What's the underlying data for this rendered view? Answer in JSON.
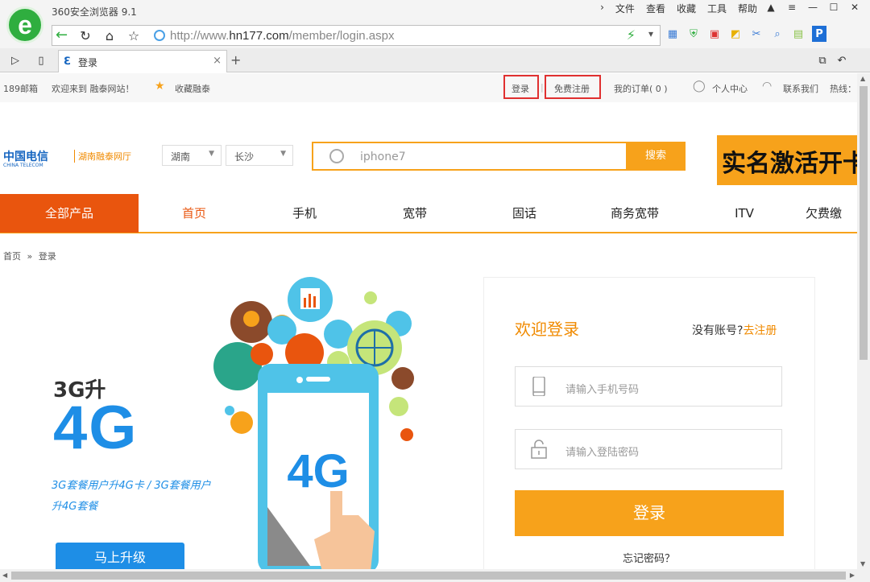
{
  "browser": {
    "app_title": "360安全浏览器 9.1",
    "menu": [
      "文件",
      "查看",
      "收藏",
      "工具",
      "帮助"
    ],
    "url_prefix": "http://www.",
    "url_domain": "hn177.com",
    "url_path": "/member/login.aspx",
    "tab_label": "登录",
    "tab_close": "×",
    "new_tab": "+"
  },
  "topbar": {
    "mail": "189邮箱",
    "welcome": "欢迎来到 融泰网站！",
    "favorite": "收藏融泰",
    "login": "登录",
    "separator": "|",
    "register": "免费注册",
    "orders": "我的订单( 0 )",
    "personal": "个人中心",
    "contact": "联系我们",
    "hotline": "热线："
  },
  "header": {
    "logo": "中国电信",
    "logo_sub": "CHINA TELECOM",
    "hall": "湖南融泰网厅",
    "province": "湖南",
    "city": "长沙",
    "search_placeholder": "iphone7",
    "search_button": "搜索",
    "banner": "实名激活开卡"
  },
  "nav": {
    "all": "全部产品",
    "items": [
      "首页",
      "手机",
      "宽带",
      "固话",
      "商务宽带",
      "ITV",
      "欠费缴"
    ]
  },
  "breadcrumb": {
    "home": "首页",
    "sep": "»",
    "current": "登录"
  },
  "promo": {
    "upgrade": "3G升",
    "big": "4G",
    "desc1": "3G套餐用户升4G卡 / 3G套餐用户",
    "desc2": "升4G套餐",
    "button": "马上升级",
    "phone_text": "4G"
  },
  "login": {
    "welcome": "欢迎登录",
    "no_account": "没有账号?",
    "register_link": "去注册",
    "phone_placeholder": "请输入手机号码",
    "password_placeholder": "请输入登陆密码",
    "button": "登录",
    "forgot": "忘记密码？"
  },
  "colors": {
    "orange": "#f7a21b",
    "nav_orange": "#e9550e",
    "blue": "#1e8ee6",
    "highlight_red": "#e03030"
  }
}
